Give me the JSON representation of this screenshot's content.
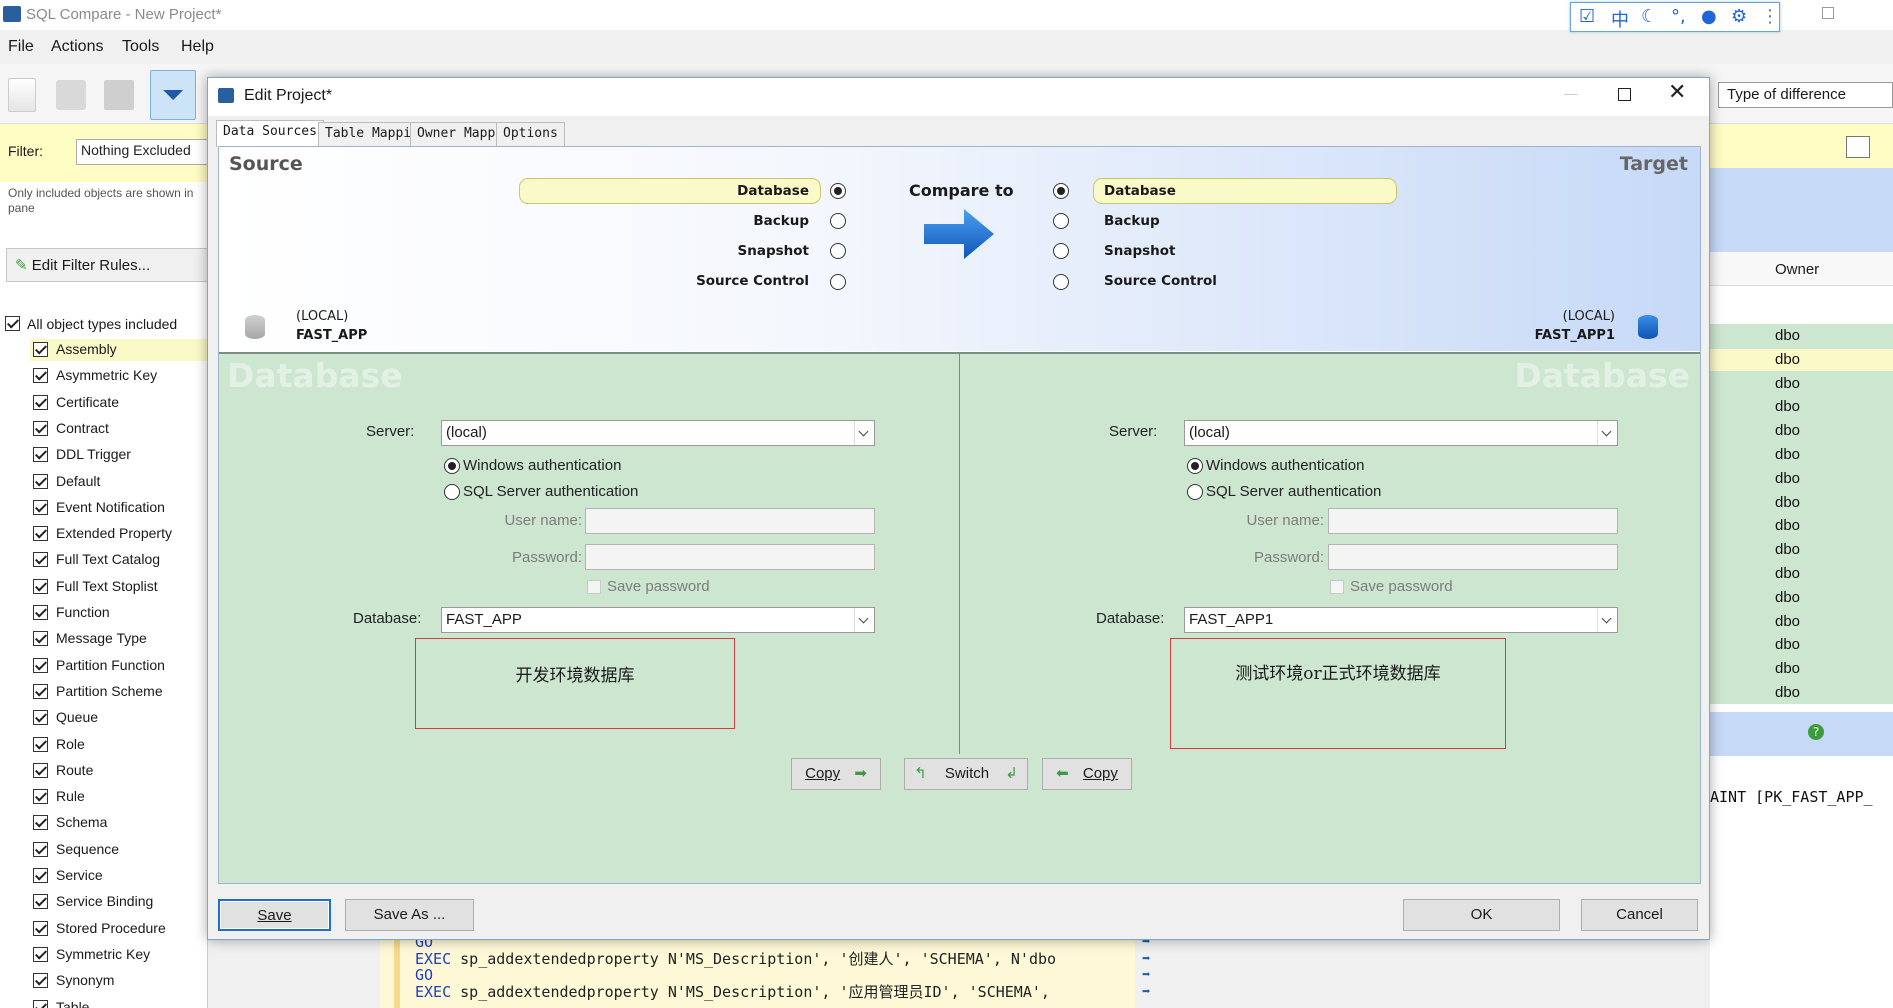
{
  "app": {
    "title": "SQL Compare - New Project*"
  },
  "menu": {
    "file": "File",
    "actions": "Actions",
    "tools": "Tools",
    "help": "Help"
  },
  "ime": {
    "chinese": "中"
  },
  "filter": {
    "label": "Filter:",
    "value": "Nothing Excluded",
    "note": "Only included objects are shown in pane",
    "edit_rules": "Edit Filter Rules...",
    "all_types": "All object types included",
    "types": [
      "Assembly",
      "Asymmetric Key",
      "Certificate",
      "Contract",
      "DDL Trigger",
      "Default",
      "Event Notification",
      "Extended Property",
      "Full Text Catalog",
      "Full Text Stoplist",
      "Function",
      "Message Type",
      "Partition Function",
      "Partition Scheme",
      "Queue",
      "Role",
      "Route",
      "Rule",
      "Schema",
      "Sequence",
      "Service",
      "Service Binding",
      "Stored Procedure",
      "Symmetric Key",
      "Synonym",
      "Table"
    ]
  },
  "right": {
    "type_of_difference": "Type of difference",
    "owner_header": "Owner",
    "owners": [
      "dbo",
      "dbo",
      "dbo",
      "dbo",
      "dbo",
      "dbo",
      "dbo",
      "dbo",
      "dbo",
      "dbo",
      "dbo",
      "dbo",
      "dbo",
      "dbo",
      "dbo",
      "dbo"
    ],
    "code_snippet": "AINT [PK_FAST_APP_"
  },
  "code": {
    "lines": [
      {
        "kw": "GO",
        "rest": ""
      },
      {
        "kw": "EXEC",
        "rest": " sp_addextendedproperty N'MS_Description', '创建人', 'SCHEMA', N'dbo"
      },
      {
        "kw": "GO",
        "rest": ""
      },
      {
        "kw": "EXEC",
        "rest": " sp_addextendedproperty N'MS_Description', '应用管理员ID', 'SCHEMA',"
      }
    ]
  },
  "dialog": {
    "title": "Edit Project*",
    "tabs": [
      "Data Sources",
      "Table Mapping",
      "Owner Mapping",
      "Options"
    ],
    "source_heading": "Source",
    "target_heading": "Target",
    "compare_to": "Compare to",
    "source_options": [
      "Database",
      "Backup",
      "Snapshot",
      "Source Control"
    ],
    "target_options": [
      "Database",
      "Backup",
      "Snapshot",
      "Source Control"
    ],
    "source_server_summary": "(LOCAL)",
    "source_db_summary": "FAST_APP",
    "target_server_summary": "(LOCAL)",
    "target_db_summary": "FAST_APP1",
    "watermark": "Database",
    "left": {
      "server_label": "Server:",
      "server": "(local)",
      "auth_windows": "Windows authentication",
      "auth_sql": "SQL Server authentication",
      "username_label": "User name:",
      "password_label": "Password:",
      "save_password": "Save password",
      "database_label": "Database:",
      "database": "FAST_APP",
      "annotation": "开发环境数据库"
    },
    "right": {
      "server_label": "Server:",
      "server": "(local)",
      "auth_windows": "Windows authentication",
      "auth_sql": "SQL Server authentication",
      "username_label": "User name:",
      "password_label": "Password:",
      "save_password": "Save password",
      "database_label": "Database:",
      "database": "FAST_APP1",
      "annotation": "测试环境or正式环境数据库"
    },
    "copy_right": "Copy",
    "switch": "Switch",
    "copy_left": "Copy",
    "save": "Save",
    "save_as": "Save As ...",
    "ok": "OK",
    "cancel": "Cancel"
  }
}
